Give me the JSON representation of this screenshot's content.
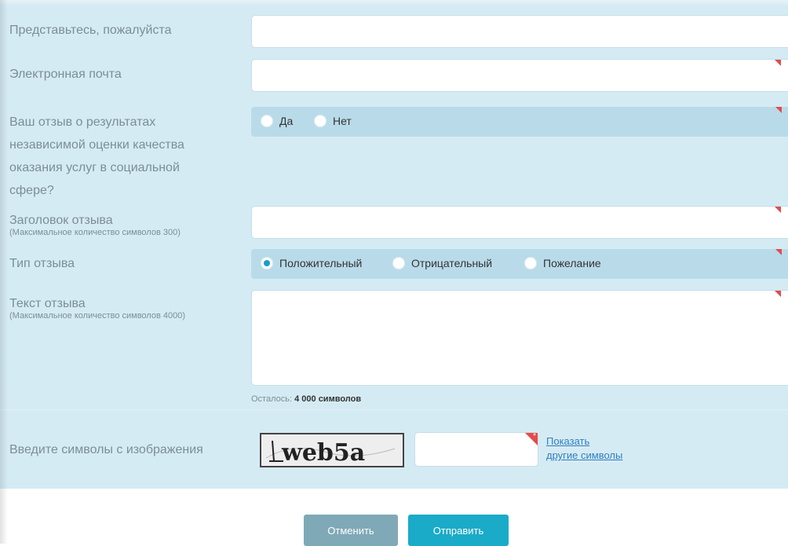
{
  "form": {
    "name_label": "Представьтесь, пожалуйста",
    "email_label": "Электронная почта",
    "question_label": "Ваш отзыв о результатах независимой оценки качества оказания услуг в социальной сфере?",
    "question_options": [
      "Да",
      "Нет"
    ],
    "title_label": "Заголовок отзыва",
    "title_hint": "(Максимальное количество символов 300)",
    "type_label": "Тип отзыва",
    "type_options": [
      "Положительный",
      "Отрицательный",
      "Пожелание"
    ],
    "type_selected": "Положительный",
    "text_label": "Текст отзыва",
    "text_hint": "(Максимальное количество символов 4000)",
    "counter_prefix": "Осталось:",
    "counter_value": "4 000 символов",
    "captcha_label": "Введите символы с изображения",
    "captcha_text": "web5a",
    "captcha_link_line1": "Показать",
    "captcha_link_line2": "другие символы"
  },
  "buttons": {
    "cancel": "Отменить",
    "submit": "Отправить"
  },
  "colors": {
    "panel_bg": "#d5ebf4",
    "required_marker": "#e34b4b",
    "radio_checked": "#1a9ccb",
    "submit_button": "#1aabc8",
    "cancel_button": "#7fa9b6",
    "link": "#2f7fc2"
  }
}
